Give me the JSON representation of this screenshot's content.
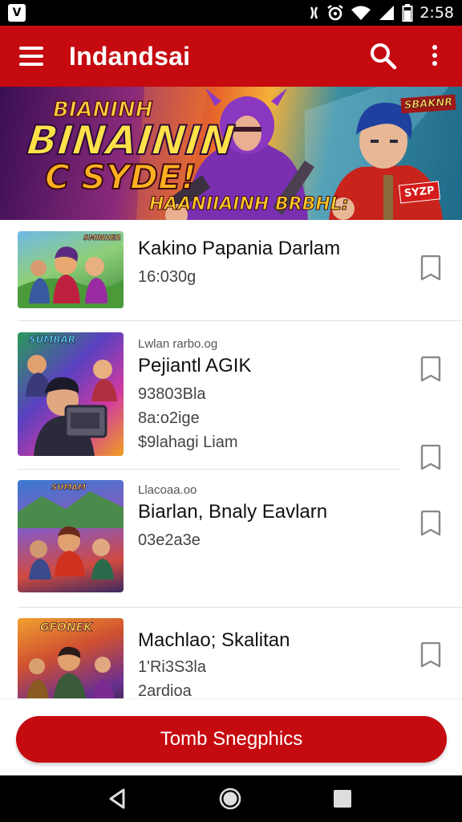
{
  "status_bar": {
    "app_icon": "V",
    "time": "2:58",
    "icons": [
      "vibrate-icon",
      "alarm-icon",
      "wifi-icon",
      "signal-icon",
      "battery-icon"
    ]
  },
  "app_bar": {
    "title": "Indandsai",
    "icons": [
      "menu-icon",
      "search-icon",
      "more-vert-icon"
    ],
    "background": "#c50a10"
  },
  "banner": {
    "line1": "BIANINH",
    "line2": "BINAININ",
    "line3": "C SYDE!",
    "subtitle": "HAANIIAINH BRBHL:",
    "corner_label": "SBAKNR",
    "badge": "SYZP"
  },
  "items": [
    {
      "thumb_label": "SMINHER",
      "pre": "",
      "title": "Kakino Papania Darlam",
      "lines": [
        "16:030g"
      ]
    },
    {
      "thumb_label": "SUMBAR",
      "pre": "Lwlan rarbo.og",
      "title": "Pejiantl AGIK",
      "lines": [
        "93803Bla",
        "8a:o2ige",
        "$9lahagi Liam"
      ]
    },
    {
      "thumb_label": "SUMAM",
      "pre": "Llacoaa.oo",
      "title": "Biarlan, Bnaly Eavlarn",
      "lines": [
        "03e2a3e"
      ]
    },
    {
      "thumb_label": "GFONEK",
      "pre": "",
      "title": "Machlao; Skalitan",
      "lines": [
        "1'Ri3S3la",
        "2ardioa"
      ]
    }
  ],
  "bottom_button": {
    "label": "Tomb Snegphics",
    "color": "#c50a10"
  },
  "nav_bar": {
    "icons": [
      "back-icon",
      "home-icon",
      "recents-icon"
    ]
  }
}
